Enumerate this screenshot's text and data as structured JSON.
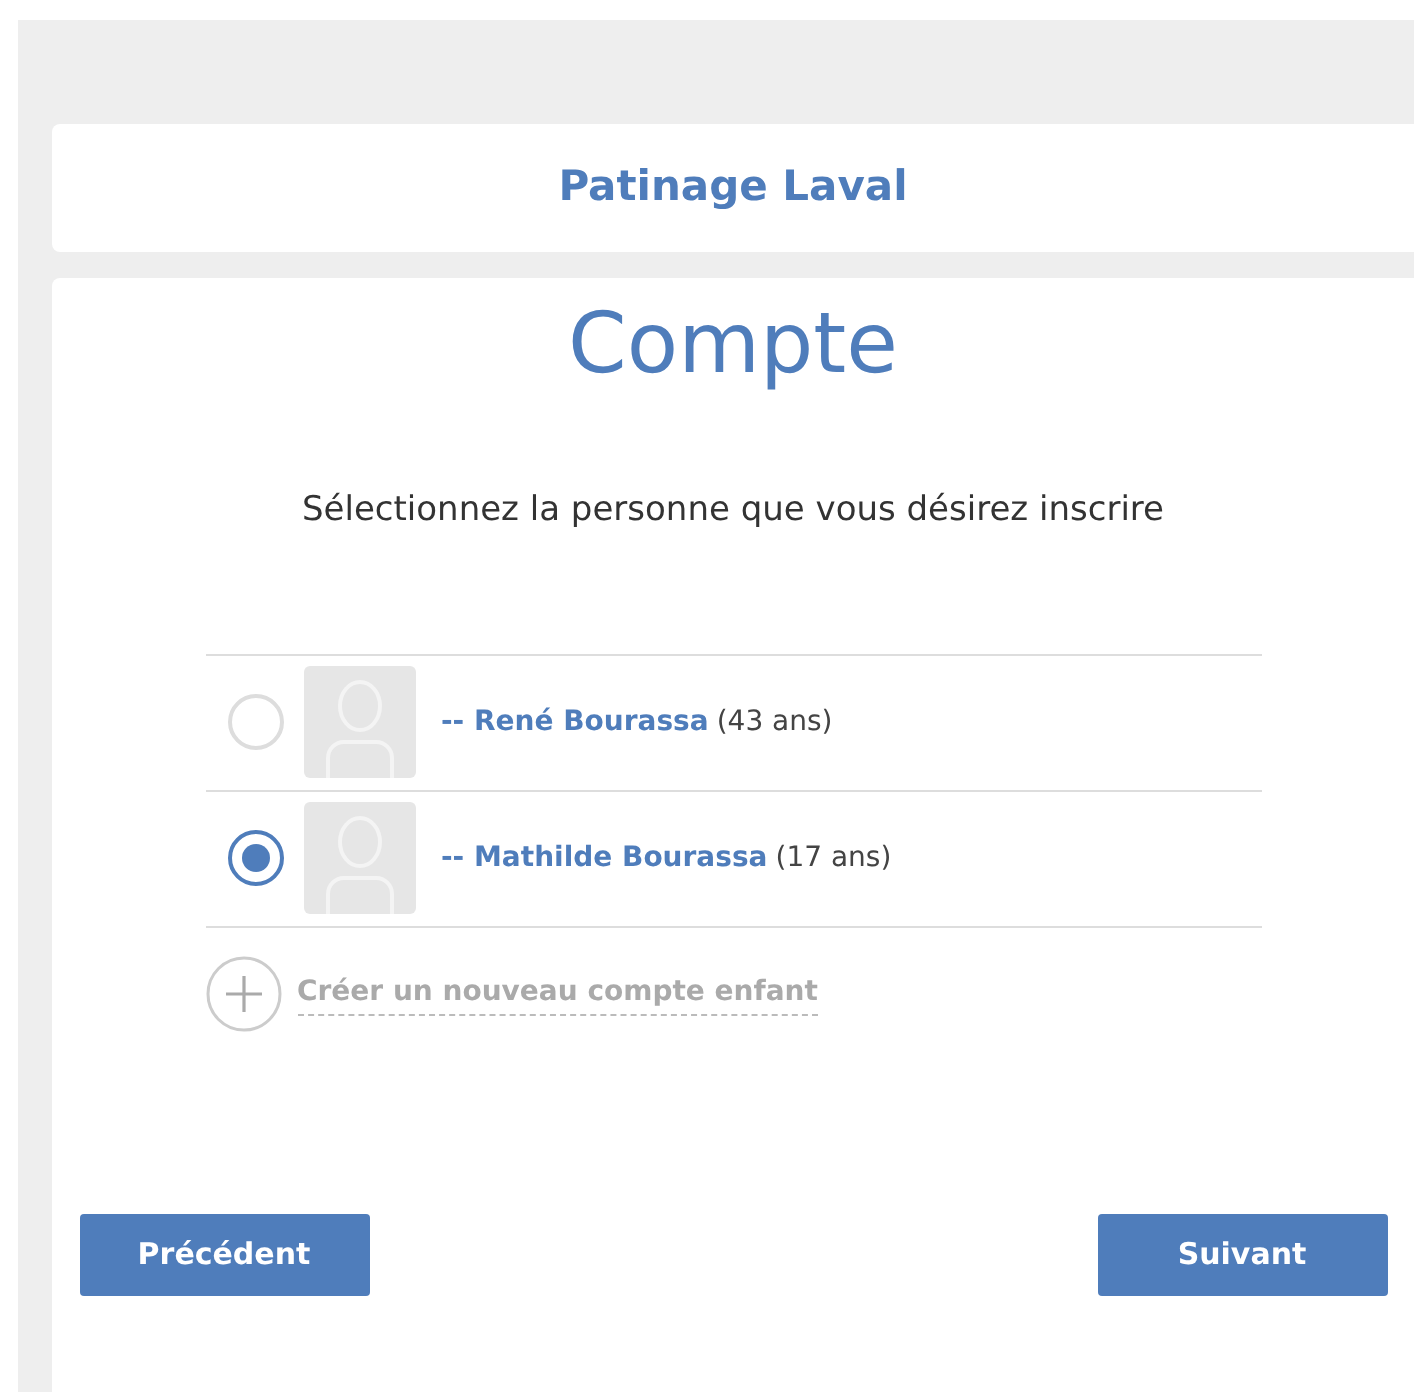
{
  "header": {
    "title": "Patinage Laval"
  },
  "page": {
    "title": "Compte",
    "instruction": "Sélectionnez la personne que vous désirez inscrire"
  },
  "persons": [
    {
      "name": "-- René Bourassa",
      "age": "(43 ans)",
      "selected": false
    },
    {
      "name": "-- Mathilde Bourassa",
      "age": "(17 ans)",
      "selected": true
    }
  ],
  "add_child": {
    "label": "Créer un nouveau compte enfant"
  },
  "buttons": {
    "previous": "Précédent",
    "next": "Suivant"
  }
}
